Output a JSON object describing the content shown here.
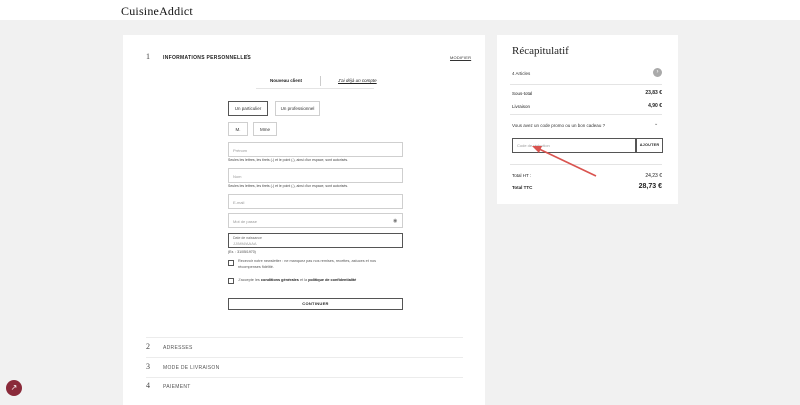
{
  "header": {
    "logo": "CuisineAddict"
  },
  "steps": {
    "personal": {
      "num": "1",
      "label": "INFORMATIONS PERSONNELLES",
      "modify": "MODIFIER"
    },
    "address": {
      "num": "2",
      "label": "ADRESSES"
    },
    "shipping": {
      "num": "3",
      "label": "MODE DE LIVRAISON"
    },
    "payment": {
      "num": "4",
      "label": "PAIEMENT"
    }
  },
  "tabs": {
    "new_client": "Nouveau client",
    "login": "J'ai déjà un compte"
  },
  "form": {
    "type_particulier": "Un particulier",
    "type_pro": "Un professionnel",
    "title_m": "M.",
    "title_mme": "Mme",
    "firstname_placeholder": "Prénom",
    "firstname_hint": "Seules les lettres, les tirets (-) et le point (.), ainsi d'un espace, sont autorisés.",
    "lastname_placeholder": "Nom",
    "lastname_hint": "Seules les lettres, les tirets (-) et le point (.), ainsi d'un espace, sont autorisés.",
    "email_placeholder": "E-mail",
    "password_placeholder": "Mot de passe",
    "birthdate_label": "Date de naissance",
    "birthdate_placeholder": "JJ/MM/AAAA",
    "birthdate_hint": "(Ex. : 31/05/1970)",
    "newsletter_text": "Recevoir notre newsletter : ne manquez pas nos remises, recettes, astuces et nos récompenses fidélité.",
    "terms_prefix": "J'accepte les",
    "terms_cgv": "conditions générales",
    "terms_mid": "et la",
    "terms_privacy": "politique de confidentialité",
    "submit": "CONTINUER"
  },
  "summary": {
    "title": "Récapitulatif",
    "articles": "4 Articles",
    "subtotal_label": "Sous-total",
    "subtotal_value": "23,83 €",
    "shipping_label": "Livraison",
    "shipping_value": "4,90 €",
    "promo_question": "Vous avez un code promo ou un bon cadeau ?",
    "promo_placeholder": "Code de réduction",
    "promo_button": "AJOUTER",
    "total_ht_label": "Total HT :",
    "total_ht_value": "24,23 €",
    "total_ttc_label": "Total TTC",
    "total_ttc_value": "28,73 €"
  },
  "colors": {
    "annotation_arrow": "#d9534f",
    "fab": "#8a2a3a"
  },
  "icons": {
    "check": "check-icon",
    "eye": "eye-icon",
    "chevron": "chevron-down-icon",
    "articles_toggle": "chevron-circle-icon",
    "fab": "tracking-icon"
  }
}
